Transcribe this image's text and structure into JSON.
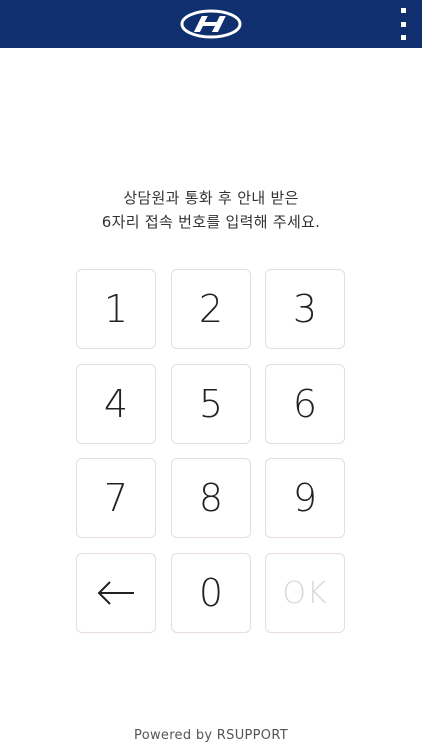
{
  "header": {
    "logo_icon": "hyundai-logo",
    "menu_icon": "more-vertical-icon",
    "background_color": "#0f2f6e"
  },
  "instructions": {
    "line1": "상담원과 통화 후 안내 받은",
    "line2": "6자리 접속 번호를 입력해 주세요."
  },
  "keypad": {
    "keys": {
      "k1": "1",
      "k2": "2",
      "k3": "3",
      "k4": "4",
      "k5": "5",
      "k6": "6",
      "k7": "7",
      "k8": "8",
      "k9": "9",
      "k0": "0",
      "ok": "OK"
    },
    "backspace_icon": "arrow-left-icon",
    "ok_disabled": true,
    "key_border_color": "#e8dcdc"
  },
  "footer": {
    "text": "Powered by RSUPPORT"
  }
}
